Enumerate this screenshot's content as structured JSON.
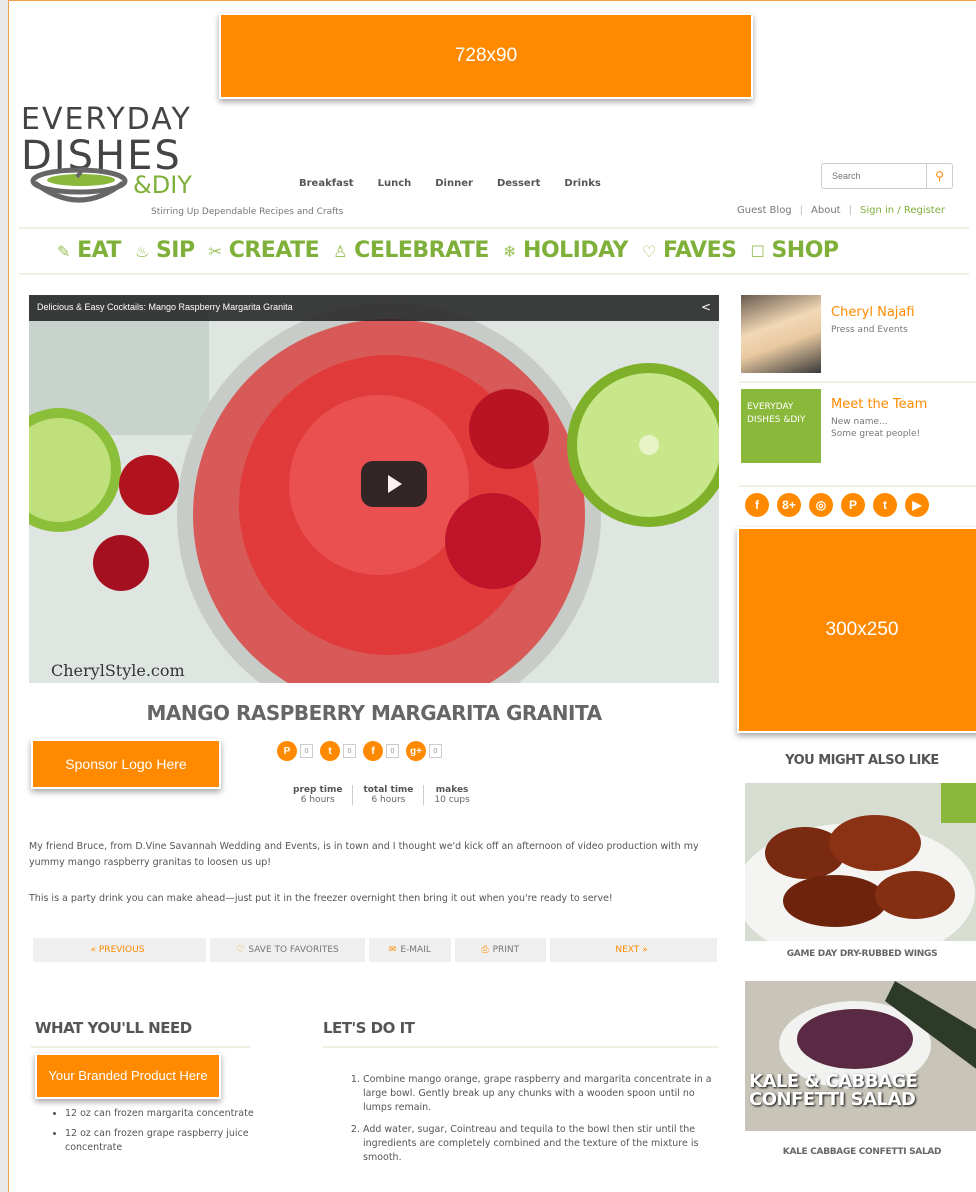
{
  "ads": {
    "leaderboard": "728x90",
    "box": "300x250",
    "sponsor": "Sponsor Logo Here",
    "branded": "Your Branded Product Here"
  },
  "logo": {
    "line1": "EVERYDAY",
    "line2": "DISHES",
    "line3": "&DIY",
    "tagline": "Stirring Up Dependable Recipes and Crafts"
  },
  "topnav": [
    "Breakfast",
    "Lunch",
    "Dinner",
    "Dessert",
    "Drinks"
  ],
  "search": {
    "placeholder": "Search"
  },
  "utilnav": {
    "guest_blog": "Guest Blog",
    "about": "About",
    "sign_in": "Sign in / Register"
  },
  "catnav": [
    {
      "icon": "✎",
      "label": "EAT"
    },
    {
      "icon": "♨",
      "label": "SIP"
    },
    {
      "icon": "✂",
      "label": "CREATE"
    },
    {
      "icon": "♙",
      "label": "CELEBRATE"
    },
    {
      "icon": "❄",
      "label": "HOLIDAY"
    },
    {
      "icon": "♡",
      "label": "FAVES"
    },
    {
      "icon": "☐",
      "label": "SHOP"
    }
  ],
  "video": {
    "title": "Delicious & Easy Cocktails: Mango Raspberry Margarita Granita",
    "watermark": "CherylStyle.com"
  },
  "recipe": {
    "title": "MANGO RASPBERRY MARGARITA GRANITA",
    "shares": [
      {
        "icon": "P",
        "count": "0"
      },
      {
        "icon": "t",
        "count": "0"
      },
      {
        "icon": "f",
        "count": "0"
      },
      {
        "icon": "g+",
        "count": "0"
      }
    ],
    "meta": [
      {
        "key": "prep time",
        "value": "6 hours"
      },
      {
        "key": "total time",
        "value": "6 hours"
      },
      {
        "key": "makes",
        "value": "10 cups"
      }
    ],
    "para1": "My friend Bruce, from D.Vine Savannah Wedding and Events, is in town and I thought we'd kick off an afternoon of video production with my yummy mango raspberry granitas to loosen us up!",
    "para2": "This is a party drink you can make ahead—just put it in the freezer overnight then bring it out when you're ready to serve!"
  },
  "actions": {
    "previous": "« PREVIOUS",
    "favorites": "SAVE TO FAVORITES",
    "email": "E-MAIL",
    "print": "PRINT",
    "next": "NEXT »"
  },
  "needs": {
    "heading": "WHAT YOU'LL NEED",
    "items": [
      "12 oz can frozen margarita concentrate",
      "12 oz can frozen grape raspberry juice concentrate"
    ]
  },
  "steps": {
    "heading": "LET'S DO IT",
    "items": [
      "Combine mango orange, grape raspberry and margarita concentrate in a large bowl. Gently break up any chunks with a wooden spoon until no lumps remain.",
      "Add water, sugar, Cointreau and tequila to the bowl then stir until the ingredients are completely combined and the texture of the mixture is smooth."
    ]
  },
  "sidebar": {
    "profile": {
      "name": "Cheryl Najafi",
      "sub": "Press and Events"
    },
    "team": {
      "name": "Meet the Team",
      "sub1": "New name...",
      "sub2": "Some great people!",
      "logo": "EVERYDAY DISHES &DIY"
    },
    "socials": [
      "f",
      "8+",
      "◎",
      "P",
      "t",
      "▶"
    ],
    "also_like": "YOU MIGHT ALSO LIKE",
    "thumbs": [
      {
        "caption": "GAME DAY DRY-RUBBED WINGS"
      },
      {
        "caption": "KALE CABBAGE CONFETTI SALAD",
        "overlay1": "KALE & CABBAGE",
        "overlay2": "CONFETTI SALAD"
      }
    ]
  },
  "colors": {
    "accent": "#ff8a00",
    "green": "#7fb03a"
  }
}
